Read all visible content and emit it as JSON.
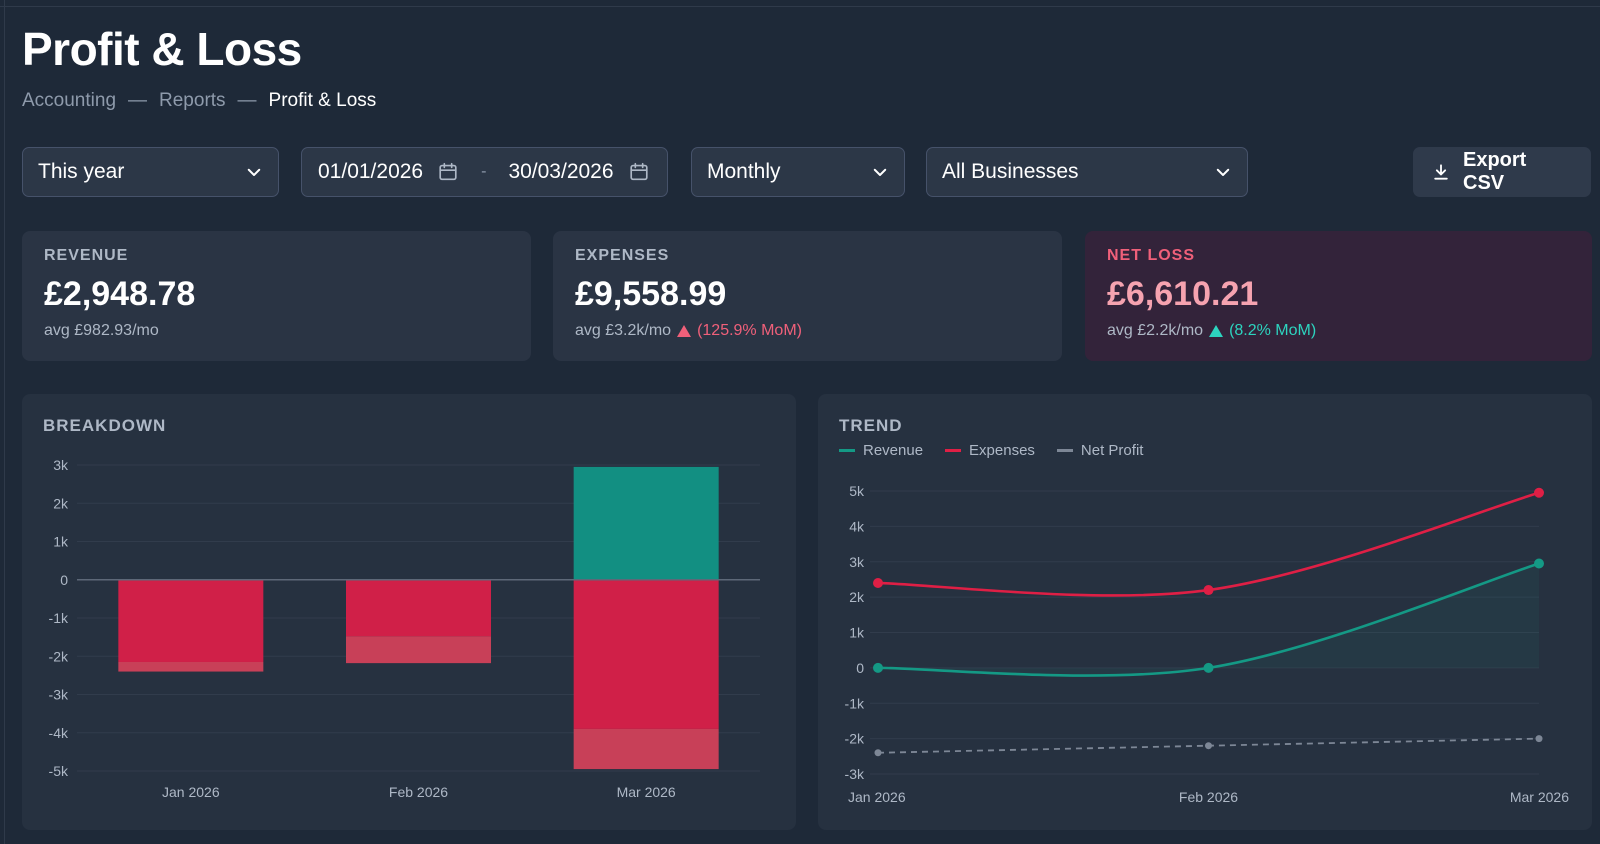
{
  "header": {
    "title": "Profit & Loss",
    "breadcrumb": [
      "Accounting",
      "Reports",
      "Profit & Loss"
    ],
    "separator": "—"
  },
  "filters": {
    "range": "This year",
    "date_from": "01/01/2026",
    "date_to": "30/03/2026",
    "date_dash": "-",
    "period": "Monthly",
    "business": "All Businesses",
    "export_label": "Export CSV"
  },
  "kpis": {
    "revenue": {
      "label": "REVENUE",
      "value": "£2,948.78",
      "avg": "avg £982.93/mo"
    },
    "expenses": {
      "label": "EXPENSES",
      "value": "£9,558.99",
      "avg": "avg £3.2k/mo",
      "change": "(125.9% MoM)"
    },
    "net_loss": {
      "label": "NET LOSS",
      "value": "£6,610.21",
      "avg": "avg £2.2k/mo",
      "change": "(8.2% MoM)"
    }
  },
  "colors": {
    "revenue": "#128f82",
    "expenses": "#d02048",
    "expenses_light": "#c84058",
    "net_profit": "#7d8796",
    "trend_revenue": "#149985",
    "trend_expenses": "#df1f45"
  },
  "breakdown": {
    "title": "BREAKDOWN",
    "chart_data": {
      "type": "bar",
      "stacked": true,
      "categories": [
        "Jan 2026",
        "Feb 2026",
        "Mar 2026"
      ],
      "ylim": [
        -5000,
        3000
      ],
      "yticks": [
        3000,
        2000,
        1000,
        0,
        -1000,
        -2000,
        -3000,
        -4000,
        -5000
      ],
      "ytick_labels": [
        "3k",
        "2k",
        "1k",
        "0",
        "-1k",
        "-2k",
        "-3k",
        "-4k",
        "-5k"
      ],
      "series": [
        {
          "values": [
            0,
            0,
            2950
          ],
          "color": "#128f82"
        },
        {
          "values": [
            -2150,
            -1480,
            -3900
          ],
          "color": "#d02048"
        },
        {
          "values": [
            -250,
            -700,
            -1050
          ],
          "color": "#c84058"
        }
      ]
    }
  },
  "trend": {
    "title": "TREND",
    "legend": [
      "Revenue",
      "Expenses",
      "Net Profit"
    ],
    "chart_data": {
      "type": "line",
      "categories": [
        "Jan 2026",
        "Feb 2026",
        "Mar 2026"
      ],
      "ylim": [
        -3000,
        5000
      ],
      "yticks": [
        5000,
        4000,
        3000,
        2000,
        1000,
        0,
        -1000,
        -2000,
        -3000
      ],
      "ytick_labels": [
        "5k",
        "4k",
        "3k",
        "2k",
        "1k",
        "0",
        "-1k",
        "-2k",
        "-3k"
      ],
      "series": [
        {
          "name": "Revenue",
          "values": [
            0,
            0,
            2950
          ],
          "color": "#149985"
        },
        {
          "name": "Expenses",
          "values": [
            2400,
            2200,
            4950
          ],
          "color": "#df1f45"
        },
        {
          "name": "Net Profit",
          "values": [
            -2400,
            -2200,
            -2000
          ],
          "color": "#7d8796",
          "dashed": true
        }
      ]
    }
  }
}
